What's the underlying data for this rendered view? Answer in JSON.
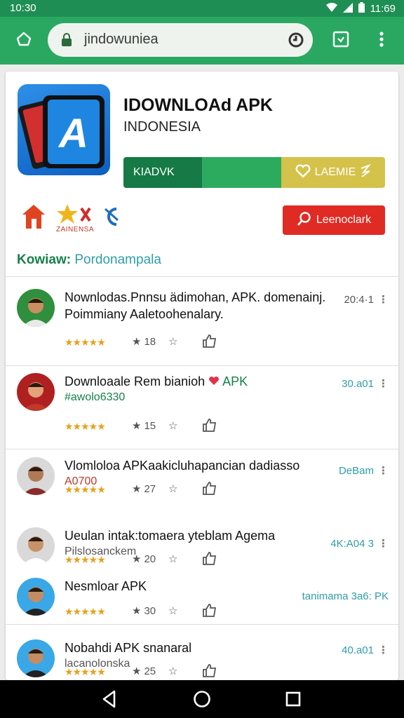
{
  "status_bar": {
    "time": "10:30",
    "clock": "11:69"
  },
  "browser": {
    "url": "jindowuniea"
  },
  "app": {
    "title": "IDOWNLOAd APK",
    "subtitle": "INDONESIA",
    "download_label": "KIADVK",
    "like_label": "LAEMIE",
    "search_label": "Leenoclark",
    "badge_text": "ZAINENSA",
    "progress": 0.6
  },
  "category": {
    "label": "Kowiaw:",
    "value": "Pordonampala"
  },
  "colors": {
    "status_bar": "#1f8e54",
    "toolbar": "#2aa862",
    "download": "#157a45",
    "progress": "#2cab5f",
    "like": "#d4c24a",
    "search": "#e02a24",
    "rating": "#e6a11c"
  },
  "items": [
    {
      "title": "Nownlodas.Pnnsu ädimohan, APK. domenainj.",
      "title2": "Poimmiany Aaletoohenalary.",
      "sub": "",
      "sub_color": "#333333",
      "count": "18",
      "time": "20:4·1",
      "time_color": "#555555",
      "rating": 4.5
    },
    {
      "title": "Downloaale Rem bianioh",
      "title_badge": "APK",
      "sub": "#awolo6330",
      "sub_color": "#16804a",
      "count": "15",
      "time": "30.a01",
      "time_color": "#2f9ea8",
      "rating": 4.5
    },
    {
      "title": "Vlomloloa APKaakicluhapancian dadiasso",
      "sub": "A0700",
      "sub_color": "#c0392b",
      "count": "27",
      "time": "DeBam",
      "time_color": "#2f9ea8",
      "rating": 4.5
    },
    {
      "title": "Ueulan intak:tomaera yteblam Agema",
      "sub": "Pilslosanckem",
      "sub_color": "#555555",
      "count": "20",
      "time": "4K:A04 3",
      "time_color": "#2f9ea8",
      "rating": 4.5
    },
    {
      "title": "Nesmloar APK",
      "sub": "",
      "sub_color": "#555555",
      "count": "30",
      "time": "tanimama 3a6: PK",
      "time_color": "#2f9ea8",
      "rating": 4.5
    },
    {
      "title": "Nobahdi APK snanaral",
      "sub": "lacanolonska",
      "sub_color": "#555555",
      "count": "25",
      "time": "40.a01",
      "time_color": "#2f9ea8",
      "rating": 4.5
    }
  ]
}
